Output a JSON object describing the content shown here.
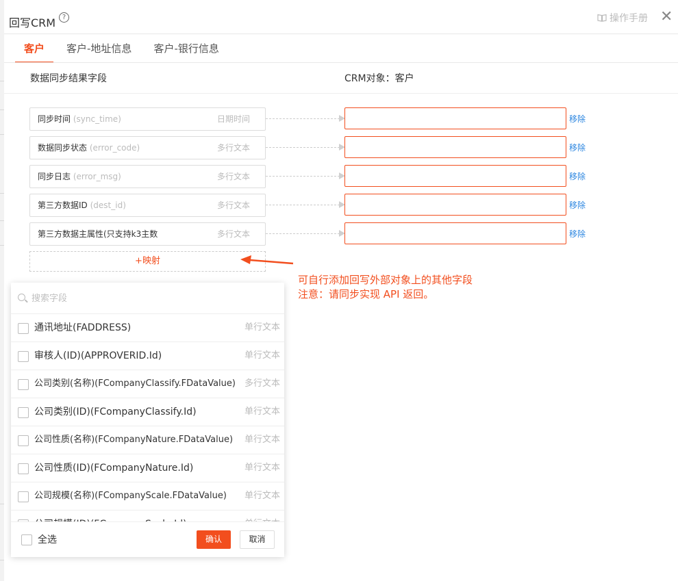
{
  "header": {
    "title": "回写CRM",
    "help_icon": "question-circle-icon",
    "manual_label": "操作手册",
    "close_icon": "close-icon"
  },
  "tabs": [
    {
      "label": "客户",
      "active": true
    },
    {
      "label": "客户-地址信息",
      "active": false
    },
    {
      "label": "客户-银行信息",
      "active": false
    }
  ],
  "columns": {
    "left": "数据同步结果字段",
    "right": "CRM对象：客户"
  },
  "mappings": [
    {
      "name": "同步时间",
      "api": "(sync_time)",
      "type": "日期时间",
      "remove": "移除"
    },
    {
      "name": "数据同步状态",
      "api": "(error_code)",
      "type": "多行文本",
      "remove": "移除"
    },
    {
      "name": "同步日志",
      "api": "(error_msg)",
      "type": "多行文本",
      "remove": "移除"
    },
    {
      "name": "第三方数据ID",
      "api": "(dest_id)",
      "type": "多行文本",
      "remove": "移除"
    },
    {
      "name": "第三方数据主属性(只支持k3主数",
      "api": "",
      "type": "多行文本",
      "remove": "移除"
    }
  ],
  "add_mapping_label": "+映射",
  "annotation": {
    "line1": "可自行添加回写外部对象上的其他字段",
    "line2": "注意：请同步实现 API 返回。"
  },
  "dropdown": {
    "search_placeholder": "搜索字段",
    "items": [
      {
        "label": "通讯地址(FADDRESS)",
        "type": "单行文本"
      },
      {
        "label": "审核人(ID)(APPROVERID.Id)",
        "type": "单行文本"
      },
      {
        "label": "公司类别(名称)(FCompanyClassify.FDataValue)",
        "type": "多行文本"
      },
      {
        "label": "公司类别(ID)(FCompanyClassify.Id)",
        "type": "单行文本"
      },
      {
        "label": "公司性质(名称)(FCompanyNature.FDataValue)",
        "type": "单行文本"
      },
      {
        "label": "公司性质(ID)(FCompanyNature.Id)",
        "type": "单行文本"
      },
      {
        "label": "公司规模(名称)(FCompanyScale.FDataValue)",
        "type": "单行文本"
      },
      {
        "label": "公司规模(ID)(FCompanyScale.Id)",
        "type": "单行文本"
      }
    ],
    "select_all": "全选",
    "confirm": "确认",
    "cancel": "取消"
  },
  "colors": {
    "accent": "#f24e1e",
    "link": "#2c86e0"
  }
}
